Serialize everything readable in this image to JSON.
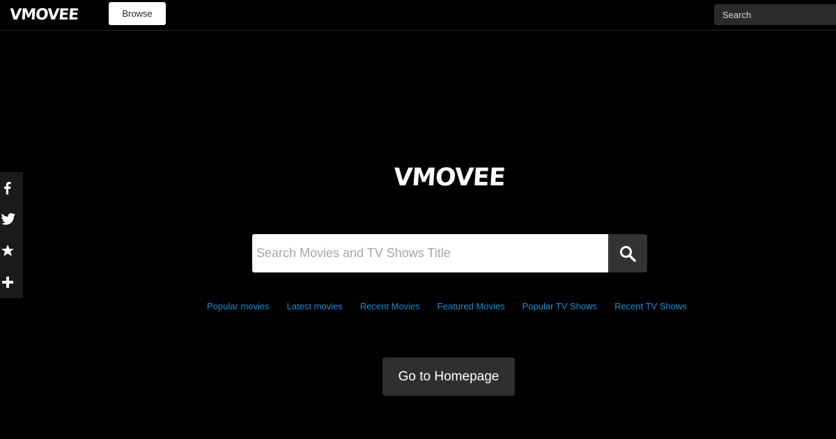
{
  "header": {
    "logo": "VMOVEE",
    "browse_label": "Browse",
    "search_placeholder": "Search"
  },
  "social": {
    "items": [
      {
        "name": "facebook-icon"
      },
      {
        "name": "twitter-icon"
      },
      {
        "name": "star-icon"
      },
      {
        "name": "plus-icon"
      }
    ]
  },
  "main": {
    "logo": "VMOVEE",
    "search_placeholder": "Search Movies and TV Shows Title",
    "search_button_icon": "search-icon",
    "links": [
      "Popular movies",
      "Latest movies",
      "Recent Movies",
      "Featured Movies",
      "Popular TV Shows",
      "Recent TV Shows"
    ],
    "home_button_label": "Go to Homepage"
  },
  "colors": {
    "background": "#000000",
    "link": "#1a8fd6",
    "button_dark": "#2f2f2f"
  }
}
